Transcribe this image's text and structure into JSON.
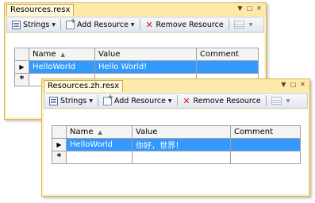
{
  "window1": {
    "title": "Resources.resx",
    "toolbar": {
      "strings": "Strings",
      "add": "Add Resource",
      "remove": "Remove Resource"
    },
    "columns": [
      "Name",
      "Value",
      "Comment"
    ],
    "row": {
      "name": "HelloWorld",
      "value": "Hello World!",
      "comment": ""
    }
  },
  "window2": {
    "title": "Resources.zh.resx",
    "toolbar": {
      "strings": "Strings",
      "add": "Add Resource",
      "remove": "Remove Resource"
    },
    "columns": [
      "Name",
      "Value",
      "Comment"
    ],
    "row": {
      "name": "HelloWorld",
      "value": "你好，世界！",
      "comment": ""
    }
  },
  "icons": [
    "strings-icon",
    "add-resource-icon",
    "remove-icon",
    "views-icon",
    "dropdown-icon",
    "row-pointer-icon",
    "new-row-icon",
    "pin-icon",
    "close-icon"
  ],
  "colors": {
    "window_frame": "#fff2c0",
    "selection": "#3399ff"
  }
}
